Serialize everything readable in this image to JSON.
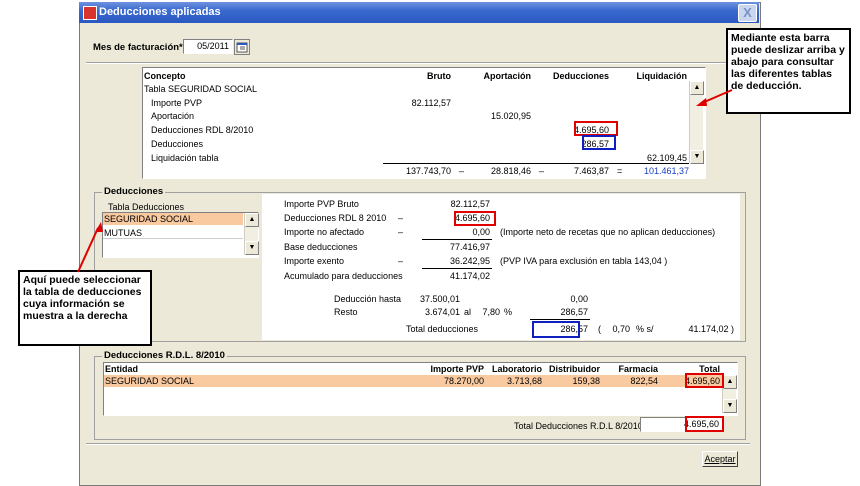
{
  "window": {
    "title": "Deducciones aplicadas",
    "close_label": "X"
  },
  "billing_month": {
    "label": "Mes de facturación*",
    "value": "05/2011"
  },
  "top_table": {
    "headers": [
      "Concepto",
      "Bruto",
      "Aportación",
      "Deducciones",
      "Liquidación"
    ],
    "rows": [
      {
        "concepto": "Tabla SEGURIDAD SOCIAL",
        "bruto": "",
        "aportacion": "",
        "deducciones": "",
        "liquidacion": ""
      },
      {
        "concepto": "Importe PVP",
        "bruto": "82.112,57",
        "aportacion": "",
        "deducciones": "",
        "liquidacion": ""
      },
      {
        "concepto": "Aportación",
        "bruto": "",
        "aportacion": "15.020,95",
        "deducciones": "",
        "liquidacion": ""
      },
      {
        "concepto": "Deducciones RDL 8/2010",
        "bruto": "",
        "aportacion": "",
        "deducciones": "4.695,60",
        "liquidacion": ""
      },
      {
        "concepto": "Deducciones",
        "bruto": "",
        "aportacion": "",
        "deducciones": "286,57",
        "liquidacion": ""
      },
      {
        "concepto": "Liquidación tabla",
        "bruto": "",
        "aportacion": "",
        "deducciones": "",
        "liquidacion": "62.109,45"
      }
    ],
    "totals": {
      "bruto": "137.743,70",
      "op1": "–",
      "aportacion": "28.818,46",
      "op2": "–",
      "deducciones": "7.463,87",
      "op3": "=",
      "liquidacion": "101.461,37"
    }
  },
  "deducciones_group": {
    "title": "Deducciones",
    "list_header": "Tabla Deducciones",
    "items": [
      "SEGURIDAD SOCIAL",
      "MUTUAS"
    ]
  },
  "detail": {
    "importe_pvp_bruto": {
      "label": "Importe PVP Bruto",
      "value": "82.112,57"
    },
    "deducciones_rdl": {
      "label": "Deducciones RDL 8 2010",
      "sign": "–",
      "value": "4.695,60"
    },
    "importe_no_afectado": {
      "label": "Importe no afectado",
      "sign": "–",
      "value": "0,00",
      "note": "(Importe neto de recetas que no aplican deducciones)"
    },
    "base_deducciones": {
      "label": "Base deducciones",
      "value": "77.416,97"
    },
    "importe_exento": {
      "label": "Importe exento",
      "sign": "–",
      "value": "36.242,95",
      "note": "(PVP IVA para exclusión en tabla  143,04 )"
    },
    "acumulado": {
      "label": "Acumulado para deducciones",
      "value": "41.174,02"
    },
    "deduccion_hasta": {
      "label": "Deducción hasta",
      "value": "37.500,01",
      "result": "0,00"
    },
    "resto": {
      "label": "Resto",
      "value": "3.674,01",
      "al": "al",
      "pct": "7,80",
      "pct_sign": "%",
      "result": "286,57"
    },
    "total_deducciones": {
      "label": "Total deducciones",
      "value": "286,57",
      "paren_open": "(",
      "pct": "0,70",
      "pct_text": "% s/",
      "base": "41.174,02 )"
    }
  },
  "rdl_group": {
    "title": "Deducciones R.D.L. 8/2010",
    "headers": [
      "Entidad",
      "Importe PVP",
      "Laboratorio",
      "Distribuidor",
      "Farmacia",
      "Total"
    ],
    "rows": [
      {
        "entidad": "SEGURIDAD SOCIAL",
        "importe_pvp": "78.270,00",
        "laboratorio": "3.713,68",
        "distribuidor": "159,38",
        "farmacia": "822,54",
        "total": "4.695,60"
      }
    ],
    "total_label": "Total Deducciones R.D.L 8/2010",
    "total_value": "4.695,60"
  },
  "accept_button": "Aceptar",
  "callouts": {
    "scrollbar": "Mediante esta barra puede deslizar arriba y abajo para consultar las diferentes tablas de deducción.",
    "list": "Aquí puede seleccionar la  tabla de deducciones cuya información se muestra a la derecha"
  },
  "colors": {
    "title_bar": "#2a58c0",
    "highlight_row": "#f9c9a0",
    "red_box": "#e00000",
    "blue_box": "#1020c0",
    "window_bg": "#ece9d8"
  }
}
